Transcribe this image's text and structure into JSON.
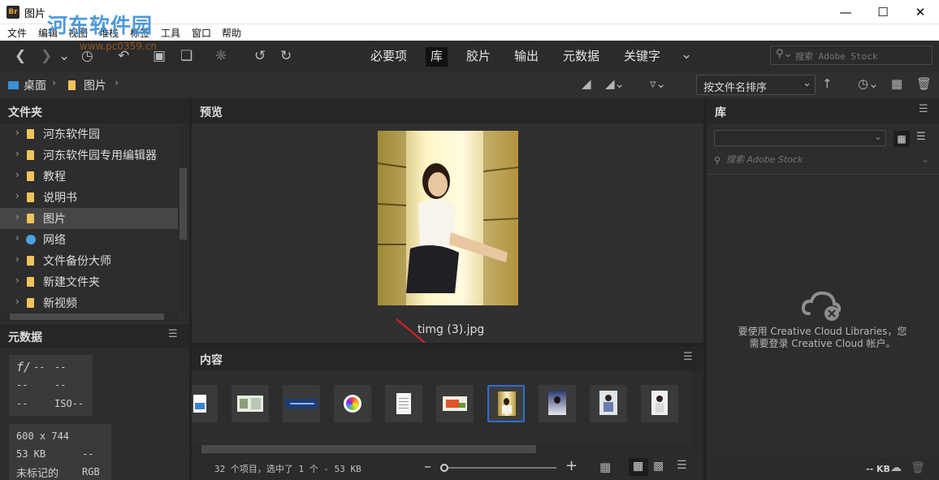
{
  "window": {
    "title": "图片",
    "app_badge": "Br",
    "watermark": "河东软件园",
    "watermark_url": "www.pc0359.cn",
    "controls": [
      "minimize-icon",
      "maximize-icon",
      "close-icon"
    ]
  },
  "menu": [
    "文件",
    "编辑",
    "视图",
    "堆栈",
    "标签",
    "工具",
    "窗口",
    "帮助"
  ],
  "toolbar": {
    "workspaces": [
      "必要项",
      "库",
      "胶片",
      "输出",
      "元数据",
      "关键字"
    ],
    "active_workspace": "库",
    "search_placeholder": "搜索 Adobe Stock"
  },
  "path": {
    "crumbs": [
      "桌面",
      "图片"
    ],
    "sort_label": "按文件名排序"
  },
  "folders": {
    "title": "文件夹",
    "items": [
      {
        "label": "河东软件园",
        "icon": "folder-icon"
      },
      {
        "label": "河东软件园专用编辑器",
        "icon": "folder-icon"
      },
      {
        "label": "教程",
        "icon": "folder-icon"
      },
      {
        "label": "说明书",
        "icon": "folder-icon"
      },
      {
        "label": "图片",
        "icon": "folder-icon",
        "selected": true
      },
      {
        "label": "网络",
        "icon": "network-icon"
      },
      {
        "label": "文件备份大师",
        "icon": "folder-icon"
      },
      {
        "label": "新建文件夹",
        "icon": "folder-icon"
      },
      {
        "label": "新视频",
        "icon": "folder-icon"
      }
    ]
  },
  "metadata": {
    "title": "元数据",
    "fstop": "f/",
    "fstop_value": "--",
    "shutter": "--",
    "row2a": "--",
    "row2b": "--",
    "row3a": "--",
    "iso": "ISO--",
    "dimensions": "600 x 744",
    "size": "53 KB",
    "size_extra": "--",
    "label_status": "未标记的",
    "color_mode": "RGB"
  },
  "preview": {
    "title": "预览",
    "caption": "timg (3).jpg"
  },
  "content": {
    "title": "内容",
    "thumbnails": [
      "image-file-icon",
      "photo-collage",
      "banner-image",
      "color-wheel-icon",
      "document-icon",
      "orange-graphic",
      "girl-library-photo",
      "portrait-photo",
      "figure-photo",
      "white-portrait-photo"
    ],
    "selected_index": 6,
    "status": "32 个项目，选中了 1 个 - 53 KB"
  },
  "library": {
    "title": "库",
    "search_placeholder": "搜索 Adobe Stock",
    "message_line1": "要使用 Creative Cloud Libraries，您",
    "message_line2": "需要登录 Creative Cloud 帐户。",
    "footer_size": "-- KB"
  }
}
